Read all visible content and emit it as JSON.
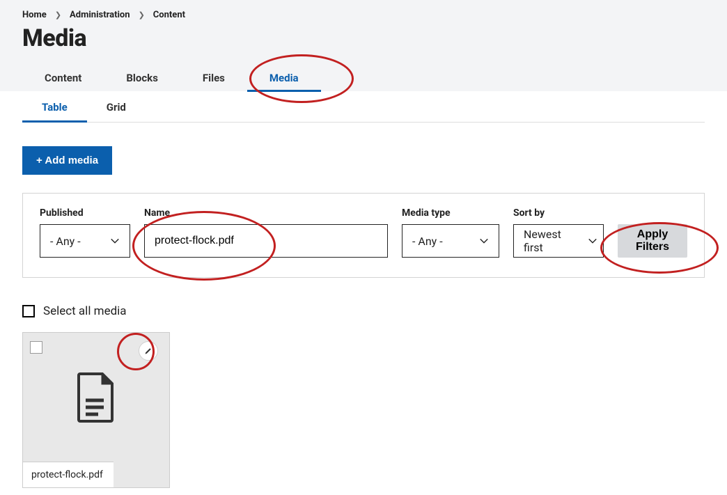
{
  "breadcrumb": {
    "items": [
      {
        "label": "Home"
      },
      {
        "label": "Administration"
      },
      {
        "label": "Content"
      }
    ]
  },
  "page_title": "Media",
  "primary_tabs": [
    {
      "label": "Content",
      "active": false
    },
    {
      "label": "Blocks",
      "active": false
    },
    {
      "label": "Files",
      "active": false
    },
    {
      "label": "Media",
      "active": true
    }
  ],
  "secondary_tabs": [
    {
      "label": "Table",
      "active": true
    },
    {
      "label": "Grid",
      "active": false
    }
  ],
  "add_button_label": "+ Add media",
  "filters": {
    "published": {
      "label": "Published",
      "value": "- Any -"
    },
    "name": {
      "label": "Name",
      "value": "protect-flock.pdf"
    },
    "media_type": {
      "label": "Media type",
      "value": "- Any -"
    },
    "sort_by": {
      "label": "Sort by",
      "value": "Newest first"
    },
    "apply_label": "Apply Filters"
  },
  "select_all_label": "Select all media",
  "results": [
    {
      "filename": "protect-flock.pdf"
    }
  ]
}
